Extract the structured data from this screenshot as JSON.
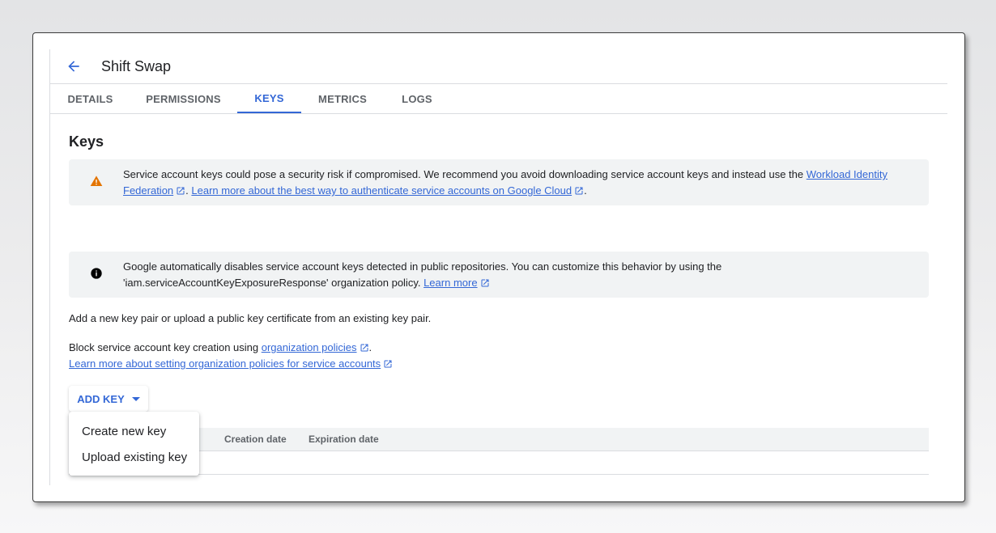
{
  "header": {
    "title": "Shift Swap"
  },
  "tabs": [
    {
      "label": "DETAILS"
    },
    {
      "label": "PERMISSIONS"
    },
    {
      "label": "KEYS"
    },
    {
      "label": "METRICS"
    },
    {
      "label": "LOGS"
    }
  ],
  "active_tab": "KEYS",
  "colors": {
    "accent": "#3367d6",
    "warning": "#e37400",
    "info_icon": "#000000"
  },
  "keys_section": {
    "title": "Keys",
    "warning": {
      "icon": "warning-icon",
      "text_before": "Service account keys could pose a security risk if compromised. We recommend you avoid downloading service account keys and instead use the ",
      "link1": "Workload Identity Federation",
      "sep": ". ",
      "link2": "Learn more about the best way to authenticate service accounts on Google Cloud",
      "end": "."
    },
    "info": {
      "icon": "info-icon",
      "text": "Google automatically disables service account keys detected in public repositories. You can customize this behavior by using the 'iam.serviceAccountKeyExposureResponse' organization policy. ",
      "link": "Learn more"
    },
    "add_key_hint": "Add a new key pair or upload a public key certificate from an existing key pair.",
    "block_text": "Block service account key creation using ",
    "block_link": "organization policies",
    "block_end": ".",
    "learn_more_policies": "Learn more about setting organization policies for service accounts",
    "add_key_button": "ADD KEY",
    "table_columns": [
      "Creation date",
      "Expiration date"
    ],
    "menu": [
      "Create new key",
      "Upload existing key"
    ]
  }
}
